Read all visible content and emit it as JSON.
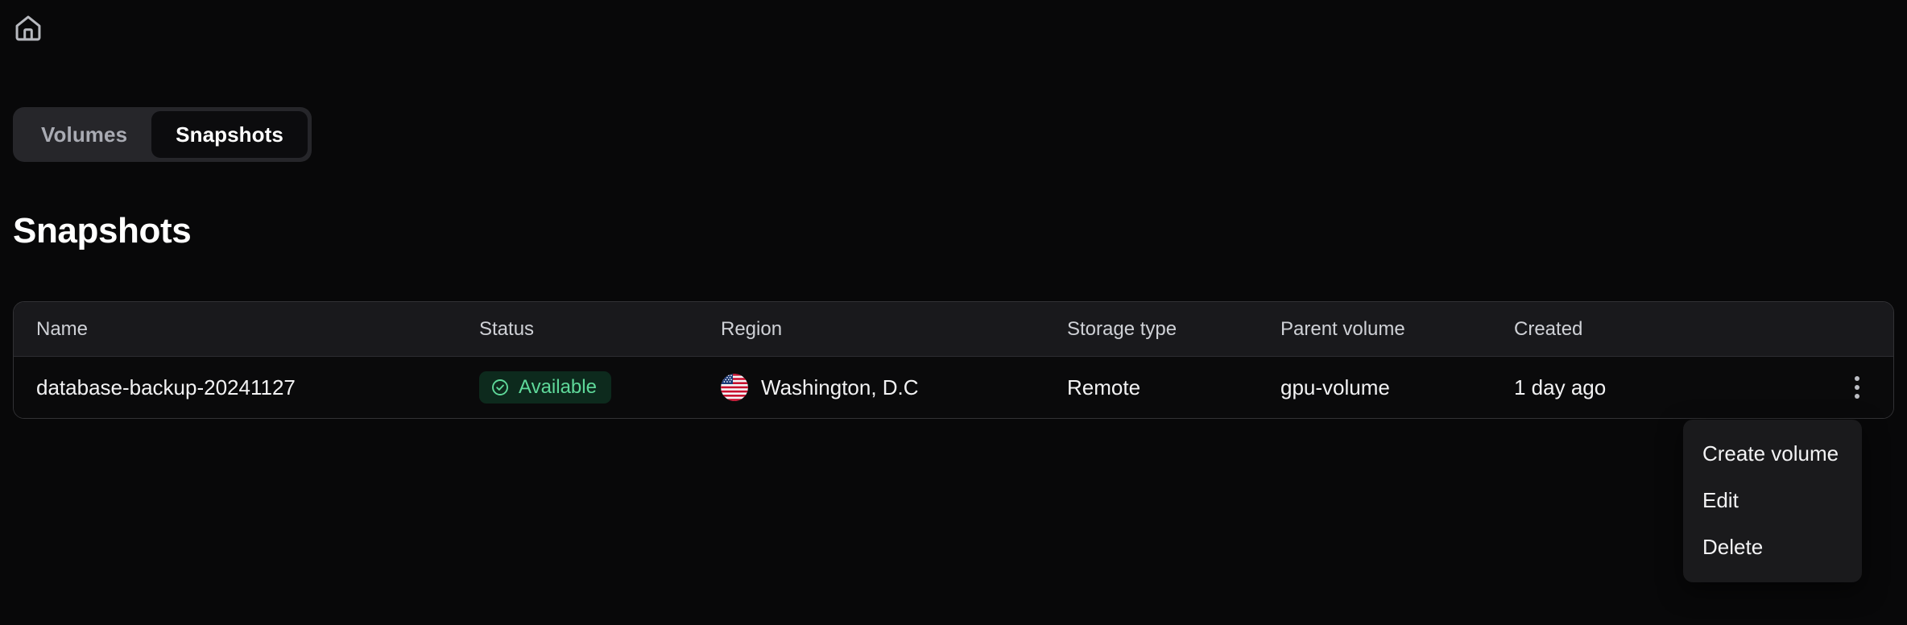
{
  "header": {
    "home_icon": "home-icon"
  },
  "tabs": {
    "items": [
      {
        "label": "Volumes",
        "active": false
      },
      {
        "label": "Snapshots",
        "active": true
      }
    ]
  },
  "page": {
    "title": "Snapshots"
  },
  "table": {
    "columns": [
      "Name",
      "Status",
      "Region",
      "Storage type",
      "Parent volume",
      "Created"
    ],
    "rows": [
      {
        "name": "database-backup-20241127",
        "status": "Available",
        "status_icon": "check-circle-icon",
        "status_color": "#5fd99a",
        "status_bg": "#0d2a1d",
        "region": "Washington, D.C",
        "region_flag": "us-flag-icon",
        "storage_type": "Remote",
        "parent_volume": "gpu-volume",
        "created": "1 day ago",
        "menu_icon": "kebab-menu-icon"
      }
    ]
  },
  "context_menu": {
    "items": [
      {
        "label": "Create volume"
      },
      {
        "label": "Edit"
      },
      {
        "label": "Delete"
      }
    ]
  }
}
